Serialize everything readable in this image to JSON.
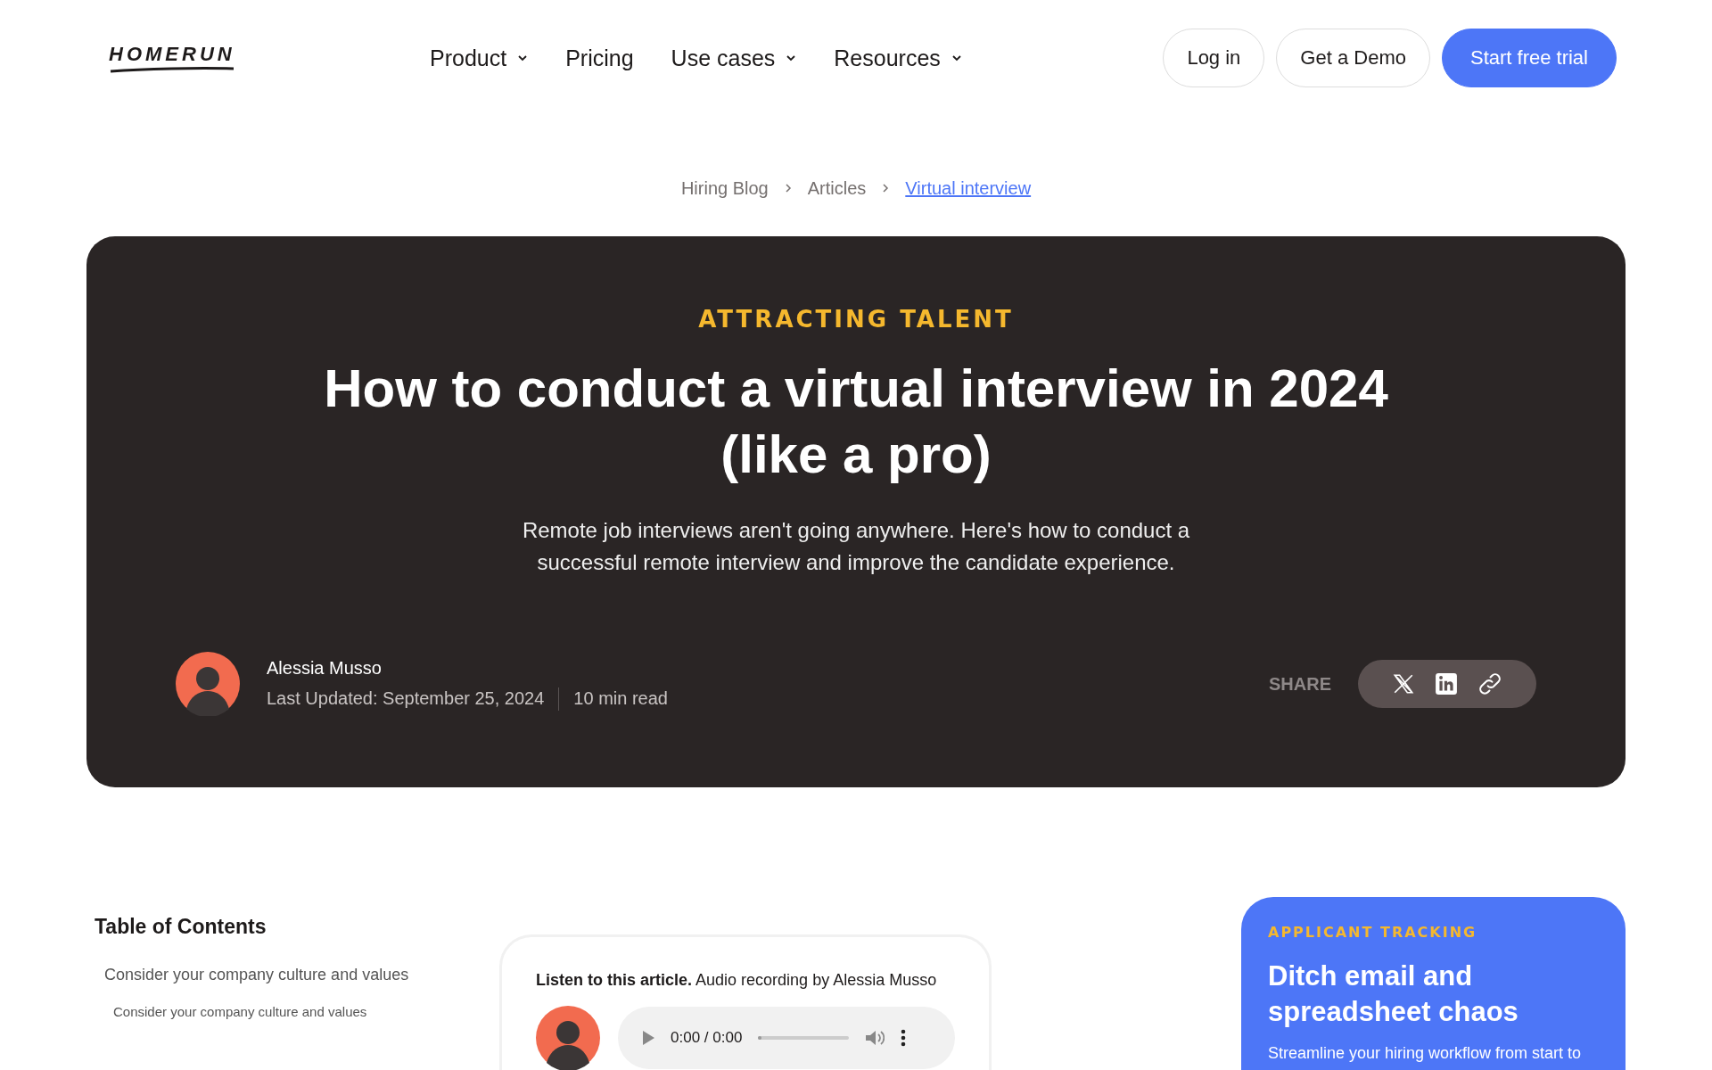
{
  "header": {
    "logo": "HOMERUN",
    "nav": [
      {
        "label": "Product",
        "dropdown": true
      },
      {
        "label": "Pricing",
        "dropdown": false
      },
      {
        "label": "Use cases",
        "dropdown": true
      },
      {
        "label": "Resources",
        "dropdown": true
      }
    ],
    "buttons": [
      {
        "label": "Log in",
        "kind": "outline"
      },
      {
        "label": "Get a Demo",
        "kind": "outline"
      },
      {
        "label": "Start free trial",
        "kind": "primary"
      }
    ]
  },
  "breadcrumb": [
    {
      "label": "Hiring Blog",
      "current": false
    },
    {
      "label": "Articles",
      "current": false
    },
    {
      "label": "Virtual interview",
      "current": true
    }
  ],
  "hero": {
    "eyebrow": "ATTRACTING TALENT",
    "title": "How to conduct a virtual interview in 2024 (like a pro)",
    "subtitle": "Remote job interviews aren't going anywhere. Here's how to conduct a successful remote interview and improve the candidate experience.",
    "author": "Alessia Musso",
    "updated": "Last Updated: September 25, 2024",
    "read_time": "10 min read",
    "share_label": "SHARE",
    "share": [
      {
        "kind": "x"
      },
      {
        "kind": "linkedin"
      },
      {
        "kind": "link"
      }
    ]
  },
  "toc": {
    "title": "Table of Contents",
    "items": [
      {
        "label": "Consider your company culture and values",
        "children": [
          {
            "label": "Consider your company culture and values"
          }
        ]
      }
    ]
  },
  "audio": {
    "intro": "**Listen to this article.** Audio recording by Alessia Musso",
    "time": "0:00 / 0:00",
    "progress": {
      "level": 0
    }
  },
  "promo": {
    "eyebrow": "APPLICANT TRACKING",
    "title": "Ditch email and spreadsheet chaos",
    "text": "Streamline your hiring workflow from start to"
  }
}
